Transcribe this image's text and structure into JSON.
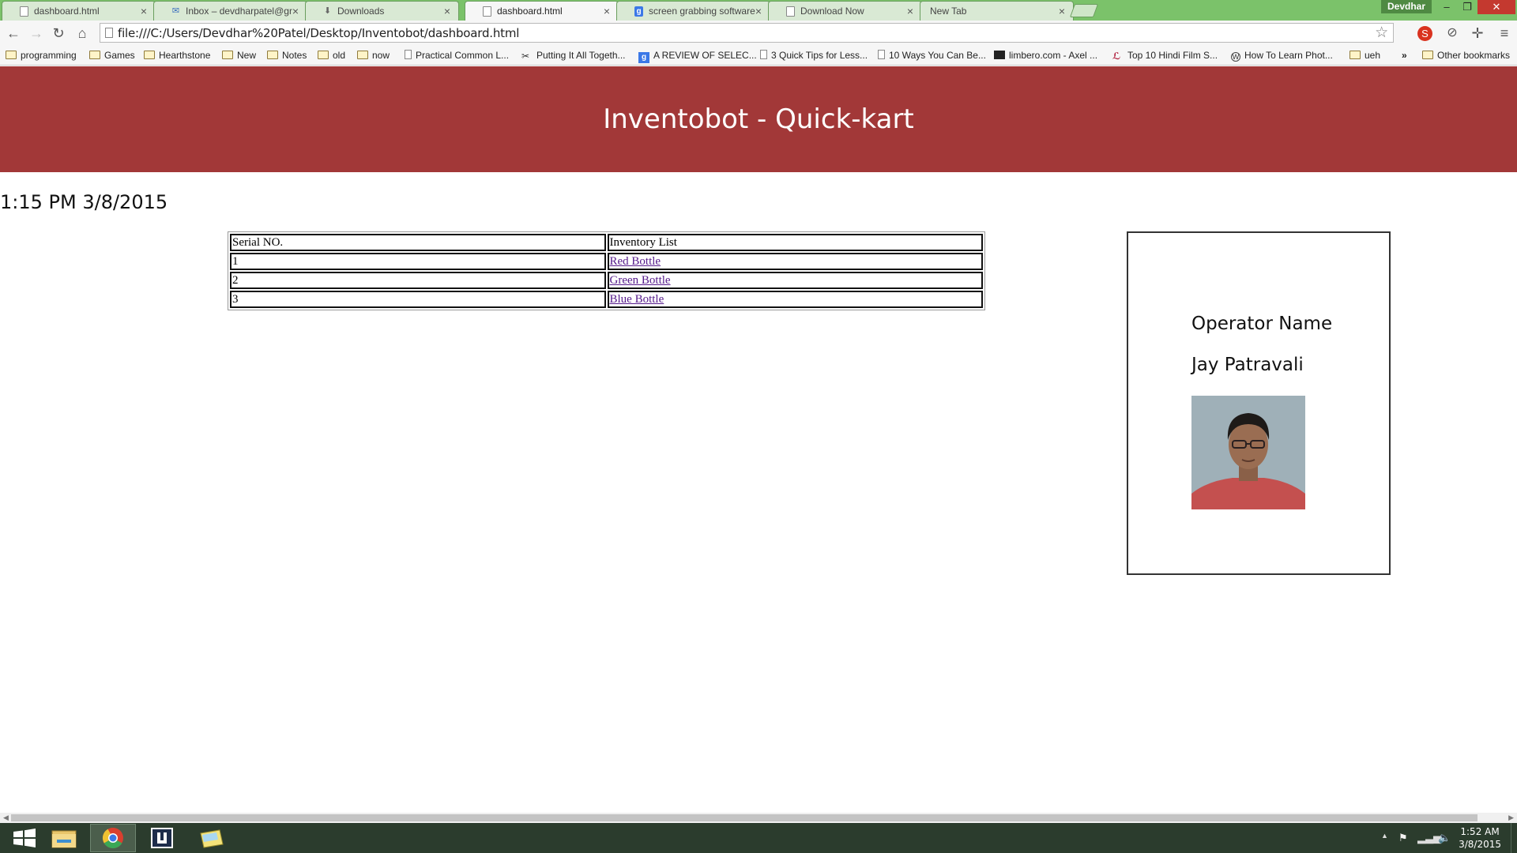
{
  "browser": {
    "tabs": [
      {
        "label": "dashboard.html",
        "icon": "page-icon",
        "active": false
      },
      {
        "label": "Inbox – devdharpatel@gm",
        "icon": "mail-icon",
        "active": false
      },
      {
        "label": "Downloads",
        "icon": "download-icon",
        "active": false
      },
      {
        "label": "dashboard.html",
        "icon": "page-icon",
        "active": true
      },
      {
        "label": "screen grabbing software",
        "icon": "google-icon",
        "active": false
      },
      {
        "label": "Download Now",
        "icon": "page-icon",
        "active": false
      },
      {
        "label": "New Tab",
        "icon": "none",
        "active": false
      }
    ],
    "close_glyph": "×",
    "user": "Devdhar",
    "url": "file:///C:/Users/Devdhar%20Patel/Desktop/Inventobot/dashboard.html",
    "bookmarks": [
      {
        "label": "programming",
        "icon": "folder-icon"
      },
      {
        "label": "Games",
        "icon": "folder-icon"
      },
      {
        "label": "Hearthstone",
        "icon": "folder-icon"
      },
      {
        "label": "New",
        "icon": "folder-icon"
      },
      {
        "label": "Notes",
        "icon": "folder-icon"
      },
      {
        "label": "old",
        "icon": "folder-icon"
      },
      {
        "label": "now",
        "icon": "folder-icon"
      },
      {
        "label": "Practical Common L...",
        "icon": "page-icon"
      },
      {
        "label": "Putting It All Togeth...",
        "icon": "tool-icon"
      },
      {
        "label": "A REVIEW OF SELEC...",
        "icon": "google-icon"
      },
      {
        "label": "3 Quick Tips for Less...",
        "icon": "page-icon"
      },
      {
        "label": "10 Ways You Can Be...",
        "icon": "page-icon"
      },
      {
        "label": "limbero.com - Axel ...",
        "icon": "site-icon"
      },
      {
        "label": "Top 10 Hindi Film S...",
        "icon": "site-icon"
      },
      {
        "label": "How To Learn Phot...",
        "icon": "wordpress-icon"
      },
      {
        "label": "ueh",
        "icon": "folder-icon"
      }
    ],
    "overflow_chevron": "»",
    "other_bookmarks": "Other bookmarks"
  },
  "page": {
    "banner_title": "Inventobot - Quick-kart",
    "datetime": "1:15 PM 3/8/2015",
    "table": {
      "headers": [
        "Serial NO.",
        "Inventory List"
      ],
      "rows": [
        {
          "serial": "1",
          "item": "Red Bottle"
        },
        {
          "serial": "2",
          "item": "Green Bottle"
        },
        {
          "serial": "3",
          "item": "Blue Bottle"
        }
      ]
    },
    "operator": {
      "heading": "Operator Name",
      "name": "Jay Patravali"
    }
  },
  "taskbar": {
    "time": "1:52 AM",
    "date": "3/8/2015"
  },
  "colors": {
    "banner": "#a23838",
    "tabstrip": "#7bc26a",
    "visited_link": "#551a8b",
    "taskbar": "#2b3c2d"
  }
}
